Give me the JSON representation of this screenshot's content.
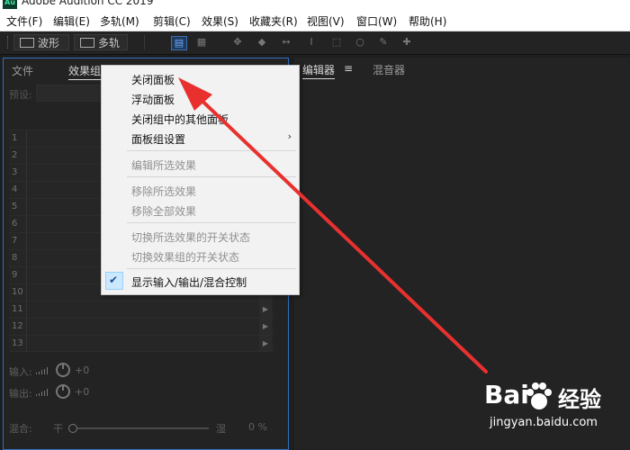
{
  "window": {
    "logo": "Au",
    "title": "Adobe Audition CC 2019"
  },
  "menubar": [
    "文件(F)",
    "编辑(E)",
    "多轨(M)",
    "剪辑(C)",
    "效果(S)",
    "收藏夹(R)",
    "视图(V)",
    "窗口(W)",
    "帮助(H)"
  ],
  "toolbar": {
    "waveform": "波形",
    "multitrack": "多轨"
  },
  "left_panel": {
    "tabs": [
      "文件",
      "效果组"
    ],
    "preset_label": "预设:",
    "rack_rows": [
      "1",
      "2",
      "3",
      "4",
      "5",
      "6",
      "7",
      "8",
      "9",
      "10",
      "11",
      "12",
      "13"
    ],
    "input_label": "输入:",
    "input_value": "+0",
    "output_label": "输出:",
    "output_value": "+0",
    "mix_label": "混合:",
    "mix_dry": "干",
    "mix_wet": "湿",
    "mix_value": "0 %"
  },
  "right_panel": {
    "tabs": [
      "编辑器",
      "混音器"
    ],
    "menu_icon": "≡"
  },
  "context_menu": {
    "items": [
      {
        "label": "关闭面板",
        "enabled": true
      },
      {
        "label": "浮动面板",
        "enabled": true
      },
      {
        "label": "关闭组中的其他面板",
        "enabled": true
      },
      {
        "label": "面板组设置",
        "enabled": true,
        "submenu": true
      },
      {
        "label": "编辑所选效果",
        "enabled": false
      },
      {
        "label": "移除所选效果",
        "enabled": false
      },
      {
        "label": "移除全部效果",
        "enabled": false
      },
      {
        "label": "切换所选效果的开关状态",
        "enabled": false
      },
      {
        "label": "切换效果组的开关状态",
        "enabled": false
      },
      {
        "label": "显示输入/输出/混合控制",
        "enabled": true,
        "checked": true
      }
    ],
    "submenu_arrow": "›",
    "check_mark": "✔"
  },
  "watermark": {
    "brand_left": "Bai",
    "brand_right": "经验",
    "url": "jingyan.baidu.com"
  },
  "colors": {
    "accent_blue": "#2f6fc0",
    "arrow_red": "#e8312f"
  }
}
